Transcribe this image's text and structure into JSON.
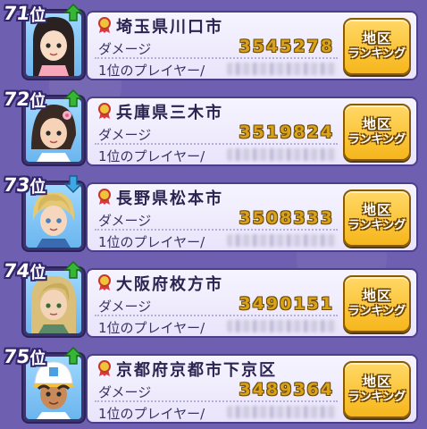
{
  "rows": [
    {
      "rank": "71",
      "suffix": "位",
      "trend": "up",
      "city": "埼玉県川口市",
      "damage_label": "ダメージ",
      "damage": "3545278",
      "top_player_label": "1位のプレイヤー/",
      "button_line1": "地区",
      "button_line2": "ランキング",
      "avatar": "girl-black-hair-icon"
    },
    {
      "rank": "72",
      "suffix": "位",
      "trend": "up",
      "city": "兵庫県三木市",
      "damage_label": "ダメージ",
      "damage": "3519824",
      "top_player_label": "1位のプレイヤー/",
      "button_line1": "地区",
      "button_line2": "ランキング",
      "avatar": "woman-flower-hair-icon"
    },
    {
      "rank": "73",
      "suffix": "位",
      "trend": "down",
      "city": "長野県松本市",
      "damage_label": "ダメージ",
      "damage": "3508333",
      "top_player_label": "1位のプレイヤー/",
      "button_line1": "地区",
      "button_line2": "ランキング",
      "avatar": "blond-boy-icon"
    },
    {
      "rank": "74",
      "suffix": "位",
      "trend": "up",
      "city": "大阪府枚方市",
      "damage_label": "ダメージ",
      "damage": "3490151",
      "top_player_label": "1位のプレイヤー/",
      "button_line1": "地区",
      "button_line2": "ランキング",
      "avatar": "blond-long-hair-icon"
    },
    {
      "rank": "75",
      "suffix": "位",
      "trend": "up",
      "city": "京都府京都市下京区",
      "damage_label": "ダメージ",
      "damage": "3489364",
      "top_player_label": "1位のプレイヤー/",
      "button_line1": "地区",
      "button_line2": "ランキング",
      "avatar": "cap-boy-icon"
    }
  ],
  "colors": {
    "background": "#6f5fb0",
    "card": "#f2effd",
    "damage_gold": "#d9a21a",
    "button_gold": "#f6b61c",
    "arrow_up": "#35b634",
    "arrow_down": "#3fa7e6"
  }
}
